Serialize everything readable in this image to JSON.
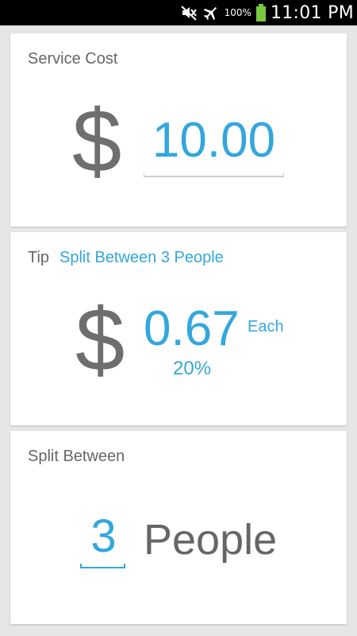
{
  "status_bar": {
    "battery_percent": "100%",
    "time": "11:01 PM",
    "icons": [
      "mute-icon",
      "airplane-icon",
      "battery-icon"
    ]
  },
  "service_cost": {
    "title": "Service Cost",
    "currency_symbol": "$",
    "value": "10.00"
  },
  "tip": {
    "title": "Tip",
    "split_text": "Split Between 3 People",
    "currency_symbol": "$",
    "amount": "0.67",
    "each_label": "Each",
    "percent": "20%"
  },
  "split_between": {
    "title": "Split Between",
    "count": "3",
    "unit_label": "People"
  },
  "colors": {
    "accent": "#33a7dd",
    "text_gray": "#666666",
    "background": "#e6e6e6",
    "battery": "#7ac943"
  }
}
